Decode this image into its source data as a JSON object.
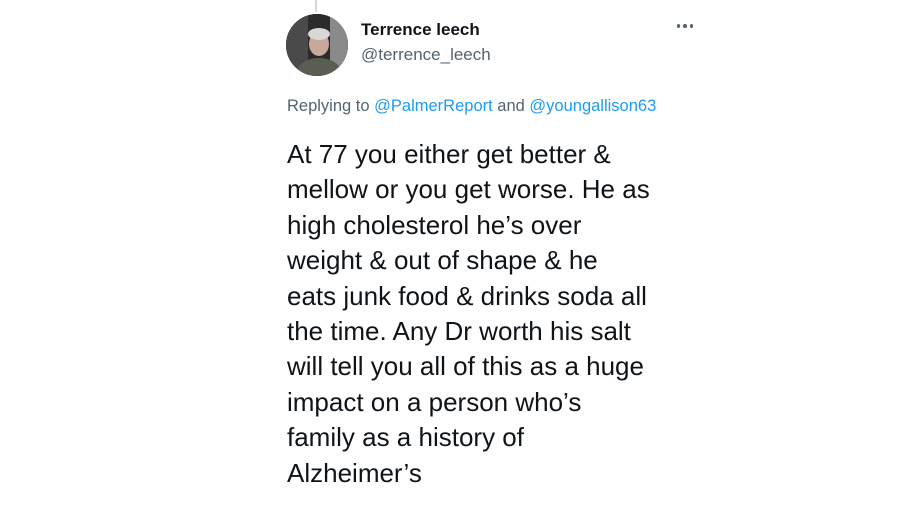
{
  "tweet": {
    "author_name": "Terrence leech",
    "author_handle": "@terrence_leech",
    "avatar_icon": "user-photo-avatar",
    "more_icon": "more-horizontal-icon",
    "replying_prefix": "Replying to",
    "reply_to": [
      "@PalmerReport",
      "@youngallison63"
    ],
    "reply_joiner": "and",
    "text_lines": [
      "At 77 you either get better &",
      "mellow or you get worse. He as",
      "high cholesterol he’s over",
      "weight & out of shape & he",
      "eats junk food & drinks soda all",
      "the time. Any Dr worth his salt",
      "will tell you all of this as a huge",
      "impact on a person who’s",
      "family as a history of",
      "Alzheimer’s"
    ]
  },
  "colors": {
    "text": "#0f1419",
    "secondary": "#536471",
    "link": "#1d9bf0",
    "background": "#ffffff"
  }
}
